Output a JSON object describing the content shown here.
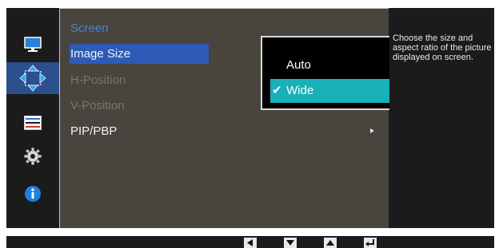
{
  "colors": {
    "menu_bg": "#4a443f",
    "active_item_bg": "#2d5bb5",
    "header_color": "#4585c8",
    "submenu_selected_bg": "#1ab0b9",
    "frame_bg": "#1b1b1b"
  },
  "sidebar": {
    "icons": [
      {
        "name": "picture-icon",
        "selected": false
      },
      {
        "name": "position-icon",
        "selected": true
      },
      {
        "name": "settings-list-icon",
        "selected": false
      },
      {
        "name": "gear-icon",
        "selected": false
      },
      {
        "name": "info-icon",
        "selected": false
      }
    ]
  },
  "menu": {
    "header": "Screen",
    "items": [
      {
        "label": "Image Size",
        "state": "active"
      },
      {
        "label": "H-Position",
        "state": "disabled"
      },
      {
        "label": "V-Position",
        "state": "disabled"
      },
      {
        "label": "PIP/PBP",
        "state": "normal",
        "has_submenu": true
      }
    ]
  },
  "submenu": {
    "options": [
      {
        "label": "Auto",
        "selected": false
      },
      {
        "label": "Wide",
        "selected": true
      }
    ]
  },
  "help": {
    "text": "Choose the size and aspect ratio of the picture displayed on screen."
  },
  "bottom_bar": {
    "buttons": [
      "left-arrow-icon",
      "down-arrow-icon",
      "up-arrow-icon",
      "enter-icon"
    ]
  }
}
